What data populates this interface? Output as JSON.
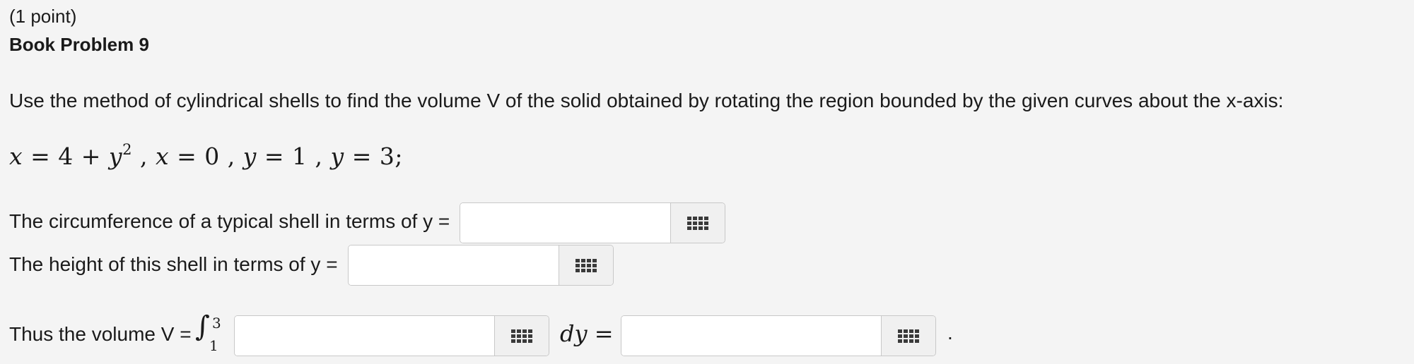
{
  "problem": {
    "points": "(1 point)",
    "title": "Book Problem 9",
    "instruction": "Use the method of cylindrical shells to find the volume V of the solid obtained by rotating the region bounded by the given curves about the x-axis:"
  },
  "equation": {
    "x": "x",
    "eq": "=",
    "four_plus": "4 +",
    "y": "y",
    "y_power": "2",
    "comma": ",",
    "zero": "0",
    "one": "1",
    "three": "3",
    "semicolon": ";"
  },
  "questions": {
    "circumference_label": "The circumference of a typical shell in terms of y =",
    "circumference_value": "",
    "height_label": "The height of this shell in terms of y =",
    "height_value": "",
    "volume_label": "Thus the volume V =",
    "integral_symbol": "∫",
    "integral_lower": "1",
    "integral_upper": "3",
    "integrand_value": "",
    "dy_text": "dy",
    "equals": "=",
    "volume_value": "",
    "trailing_period": "."
  },
  "icons": {
    "equation_palette": "grid-icon"
  }
}
